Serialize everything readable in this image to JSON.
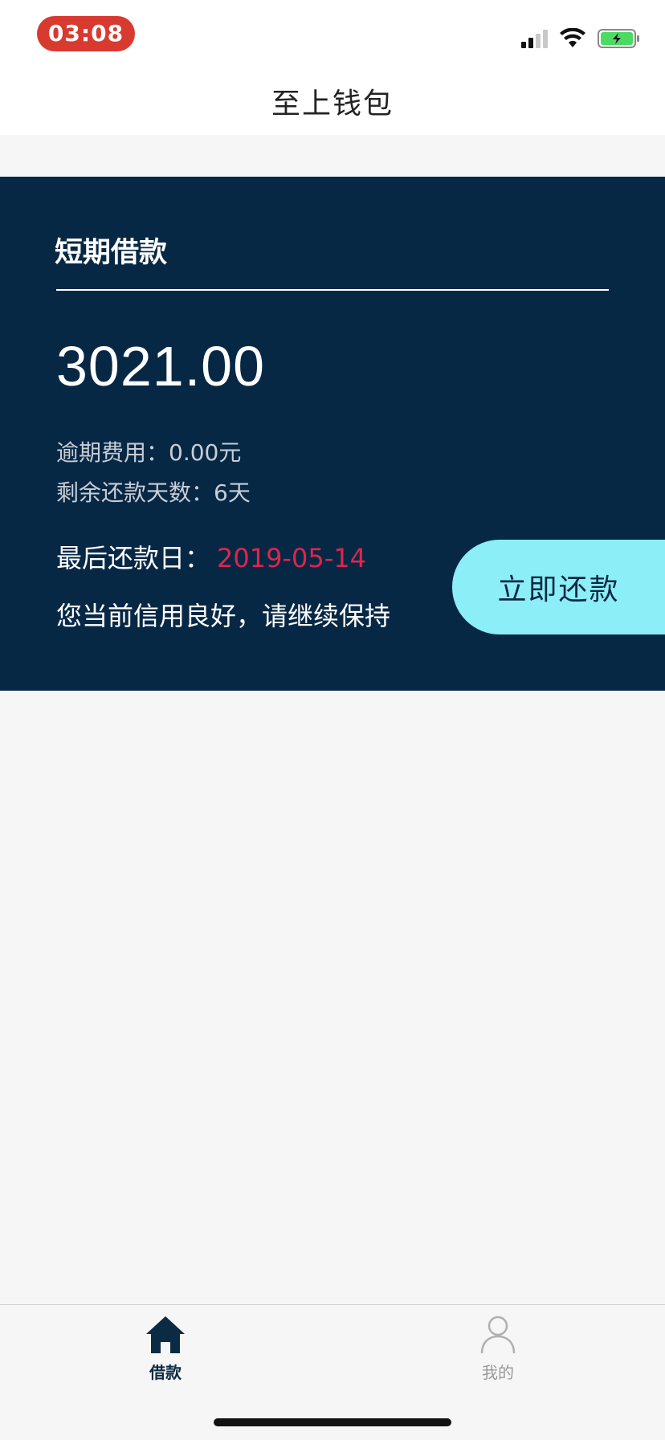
{
  "status_bar": {
    "time": "03:08",
    "icons": [
      "cellular-signal-icon",
      "wifi-icon",
      "battery-charging-icon"
    ],
    "time_pill_color": "#d93a30"
  },
  "nav": {
    "title": "至上钱包"
  },
  "loan_card": {
    "heading": "短期借款",
    "amount": "3021.00",
    "overdue_fee_label": "逾期费用：",
    "overdue_fee_value": "0.00元",
    "remaining_days_label": "剩余还款天数：",
    "remaining_days_value": "6天",
    "due_date_label": "最后还款日：",
    "due_date_value": "2019-05-14",
    "credit_message": "您当前信用良好，请继续保持",
    "repay_button_label": "立即还款",
    "background_color": "#072845",
    "due_date_color": "#e0244b",
    "button_color": "#8ceef6"
  },
  "tab_bar": {
    "tabs": [
      {
        "label": "借款",
        "icon": "home-icon",
        "active": true
      },
      {
        "label": "我的",
        "icon": "person-icon",
        "active": false
      }
    ]
  }
}
